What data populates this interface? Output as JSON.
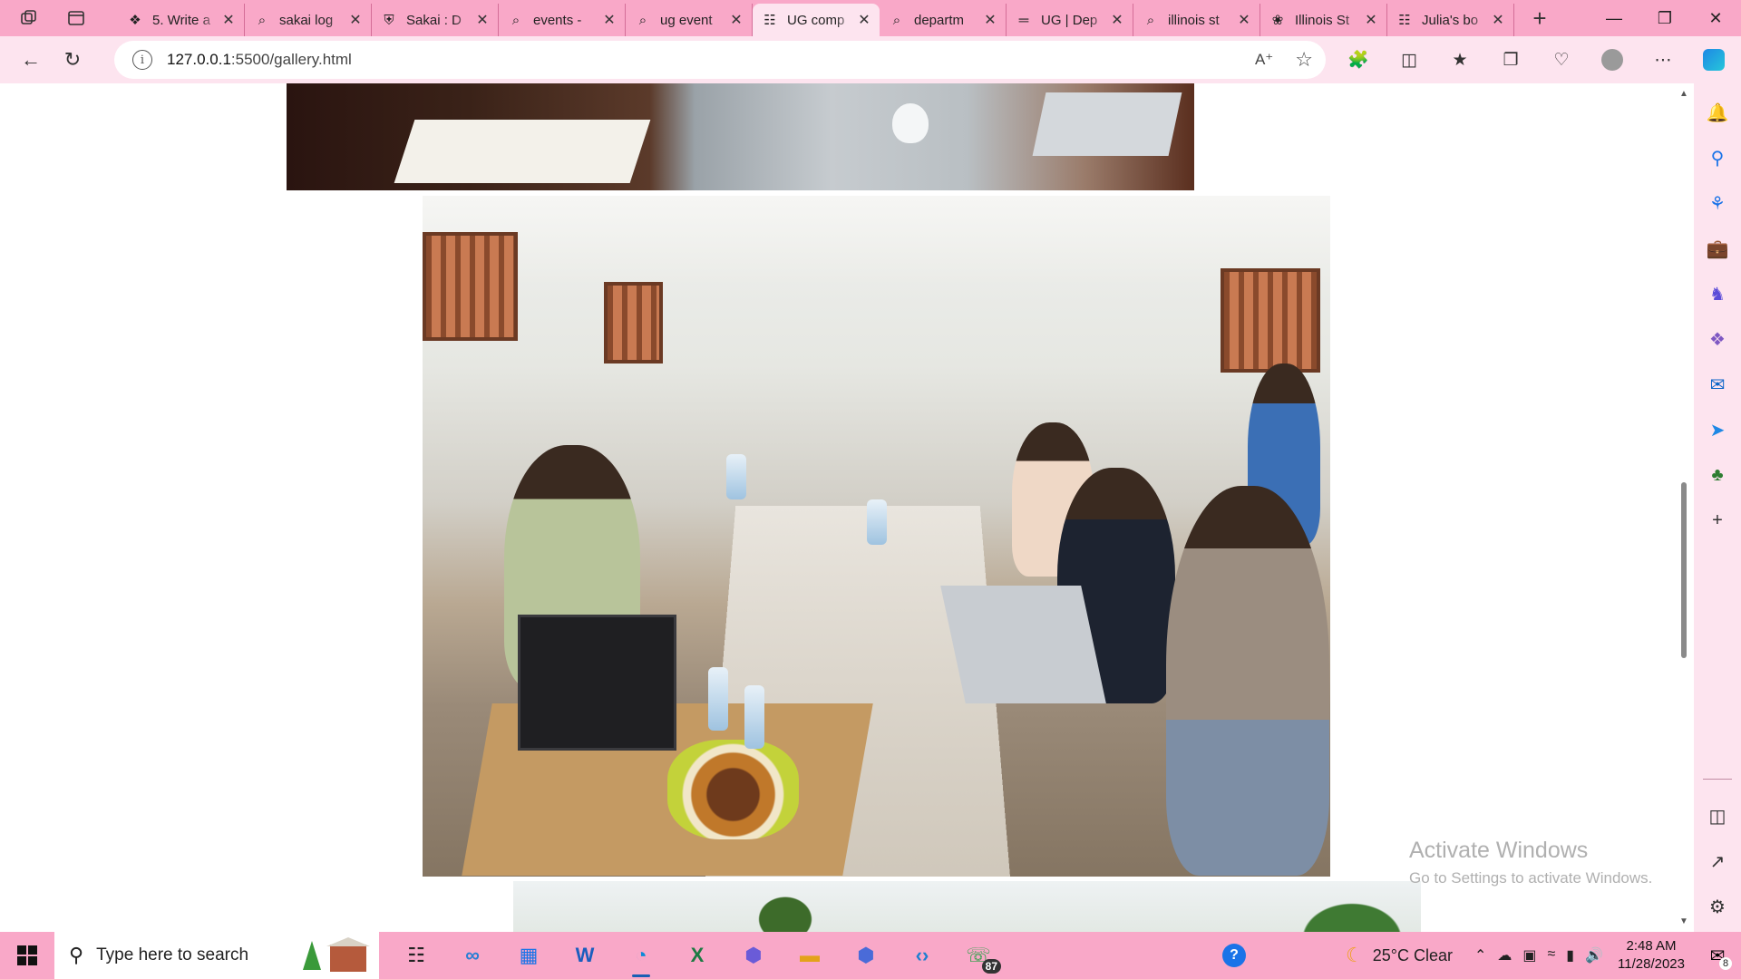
{
  "browser": {
    "tabs": [
      {
        "title": "5. Write a",
        "icon": "tasks-icon",
        "active": false
      },
      {
        "title": "sakai log",
        "icon": "search-icon",
        "active": false
      },
      {
        "title": "Sakai : D",
        "icon": "shield-icon",
        "active": false
      },
      {
        "title": "events -",
        "icon": "search-icon",
        "active": false
      },
      {
        "title": "ug event",
        "icon": "search-icon",
        "active": false
      },
      {
        "title": "UG comp",
        "icon": "page-icon",
        "active": true
      },
      {
        "title": "departm",
        "icon": "search-icon",
        "active": false
      },
      {
        "title": "UG | Dep",
        "icon": "site-icon",
        "active": false
      },
      {
        "title": "illinois st",
        "icon": "search-icon",
        "active": false
      },
      {
        "title": "Illinois St",
        "icon": "bird-icon",
        "active": false
      },
      {
        "title": "Julia's bo",
        "icon": "page-icon",
        "active": false
      }
    ],
    "address": {
      "host": "127.0.0.1",
      "path": ":5500/gallery.html"
    }
  },
  "page": {
    "photos": [
      {
        "name": "gallery-photo-workspace-notebook"
      },
      {
        "name": "gallery-photo-students-coding-session"
      },
      {
        "name": "gallery-photo-palm-trees"
      }
    ]
  },
  "watermark": {
    "line1": "Activate Windows",
    "line2": "Go to Settings to activate Windows."
  },
  "taskbar": {
    "search_placeholder": "Type here to search",
    "apps": [
      {
        "name": "task-view-icon",
        "active": false
      },
      {
        "name": "copilot-infinity-icon",
        "active": false
      },
      {
        "name": "microsoft-store-icon",
        "active": false
      },
      {
        "name": "word-icon",
        "active": false
      },
      {
        "name": "edge-icon",
        "active": true
      },
      {
        "name": "excel-icon",
        "active": false
      },
      {
        "name": "copilot-icon",
        "active": false
      },
      {
        "name": "file-explorer-icon",
        "active": false
      },
      {
        "name": "copilot-alt-icon",
        "active": false
      },
      {
        "name": "vscode-icon",
        "active": false
      },
      {
        "name": "whatsapp-icon",
        "active": false
      }
    ],
    "whatsapp_badge": "87",
    "weather": {
      "temp": "25°C",
      "condition": "Clear"
    },
    "clock": {
      "time": "2:48 AM",
      "date": "11/28/2023"
    },
    "notification_count": "8"
  },
  "colors": {
    "chrome": "#f9a8c8",
    "chrome_light": "#fde4ef"
  }
}
